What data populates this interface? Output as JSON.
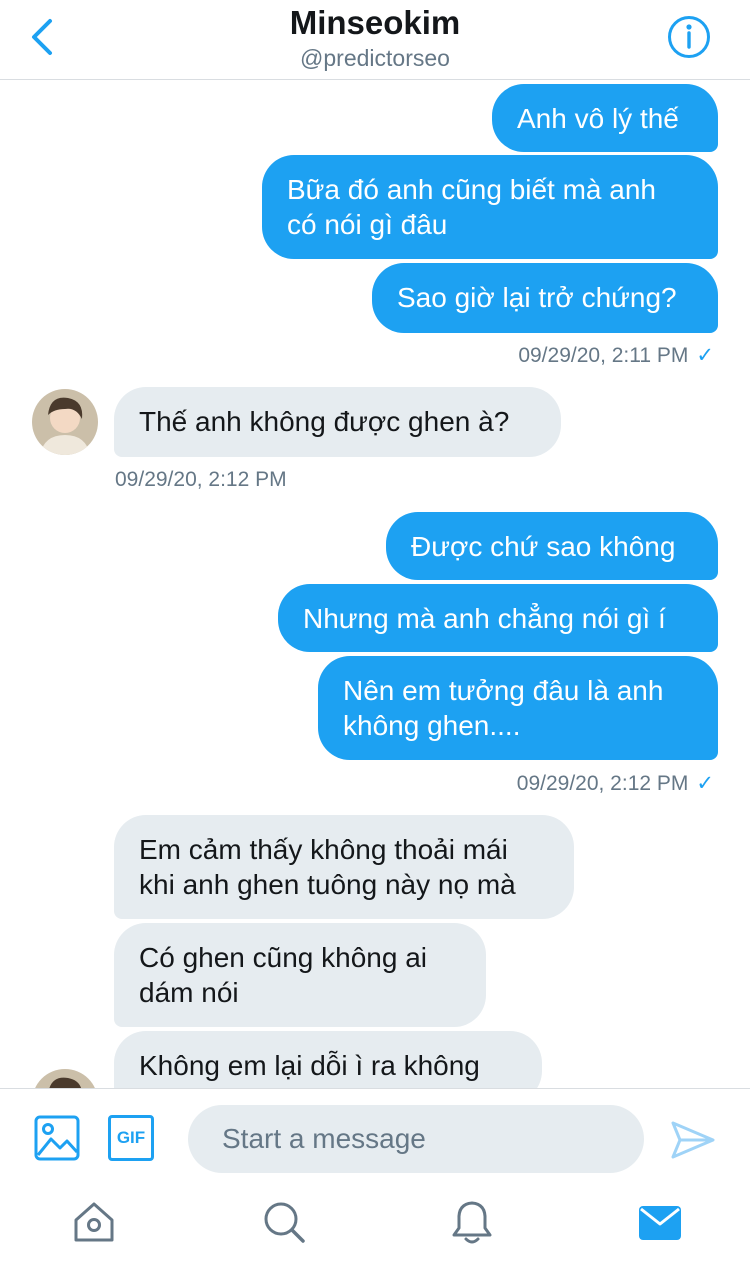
{
  "header": {
    "back_icon": "chevron-left-icon",
    "title": "Minseokim",
    "handle": "@predictorseo",
    "info_icon": "info-icon"
  },
  "messages": [
    {
      "direction": "out",
      "text": "Anh vô lý thế"
    },
    {
      "direction": "out",
      "text": "Bữa đó anh cũng biết mà anh có nói gì đâu"
    },
    {
      "direction": "out",
      "text": "Sao giờ lại trở chứng?"
    },
    {
      "type": "timestamp",
      "direction": "out",
      "text": "09/29/20, 2:11 PM",
      "check": "✓"
    },
    {
      "direction": "in",
      "text": "Thế anh không được ghen à?"
    },
    {
      "type": "timestamp",
      "direction": "in",
      "text": "09/29/20, 2:12 PM"
    },
    {
      "direction": "out",
      "text": "Được chứ sao không"
    },
    {
      "direction": "out",
      "text": "Nhưng mà anh chẳng nói gì í"
    },
    {
      "direction": "out",
      "text": "Nên em tưởng đâu là anh không ghen...."
    },
    {
      "type": "timestamp",
      "direction": "out",
      "text": "09/29/20, 2:12 PM",
      "check": "✓"
    },
    {
      "direction": "in",
      "text": "Em cảm thấy không thoải mái khi anh ghen tuông này nọ mà"
    },
    {
      "direction": "in",
      "text": "Có ghen cũng không ai dám nói"
    },
    {
      "direction": "in",
      "text": "Không em lại dỗi ì ra không"
    }
  ],
  "composer": {
    "image_icon": "image-icon",
    "gif_label": "GIF",
    "placeholder": "Start a message",
    "send_icon": "send-icon"
  },
  "tabbar": {
    "items": [
      {
        "icon": "home-icon"
      },
      {
        "icon": "search-icon"
      },
      {
        "icon": "notifications-icon"
      },
      {
        "icon": "messages-icon",
        "active": true
      }
    ]
  },
  "colors": {
    "accent": "#1da1f2",
    "incoming_bubble": "#e6ecf0",
    "secondary_text": "#657786"
  }
}
